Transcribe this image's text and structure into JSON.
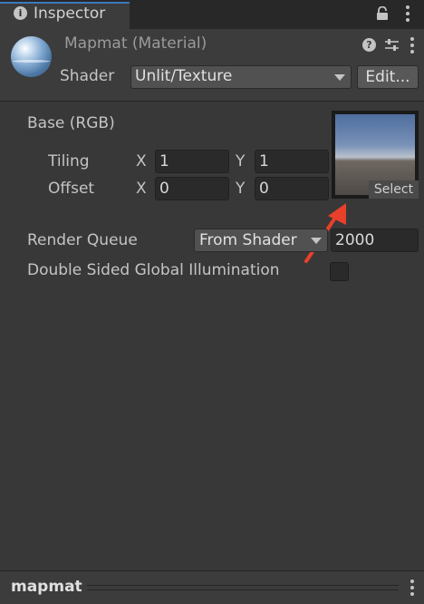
{
  "tab": {
    "title": "Inspector",
    "icon": "info-icon"
  },
  "header": {
    "title": "Mapmat (Material)",
    "shader_label": "Shader",
    "shader_value": "Unlit/Texture",
    "edit_label": "Edit..."
  },
  "texture": {
    "label": "Base (RGB)",
    "select_label": "Select",
    "tiling": {
      "label": "Tiling",
      "x_label": "X",
      "x": "1",
      "y_label": "Y",
      "y": "1"
    },
    "offset": {
      "label": "Offset",
      "x_label": "X",
      "x": "0",
      "y_label": "Y",
      "y": "0"
    }
  },
  "render_queue": {
    "label": "Render Queue",
    "mode": "From Shader",
    "value": "2000"
  },
  "double_sided_gi": {
    "label": "Double Sided Global Illumination",
    "checked": false
  },
  "footer": {
    "title": "mapmat"
  },
  "colors": {
    "background": "#383838",
    "field": "#2a2a2a",
    "accent_tab": "#3a79bb",
    "arrow": "#e8402a"
  }
}
